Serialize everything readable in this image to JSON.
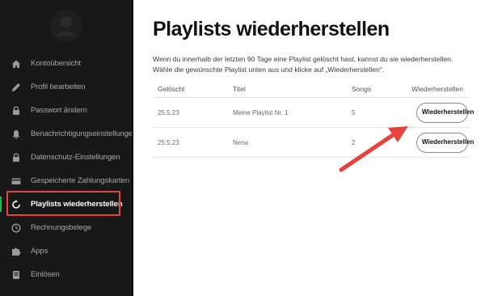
{
  "sidebar": {
    "items": [
      {
        "label": "Kontoübersicht",
        "icon": "home-icon",
        "active": false
      },
      {
        "label": "Profil bearbeiten",
        "icon": "pencil-icon",
        "active": false
      },
      {
        "label": "Passwort ändern",
        "icon": "lock-icon",
        "active": false
      },
      {
        "label": "Benachrichtigungseinstellungen",
        "icon": "bell-icon",
        "active": false
      },
      {
        "label": "Datenschutz-Einstellungen",
        "icon": "lock-icon",
        "active": false
      },
      {
        "label": "Gespeicherte Zahlungskarten",
        "icon": "credit-card-icon",
        "active": false
      },
      {
        "label": "Playlists wiederherstellen",
        "icon": "restore-icon",
        "active": true
      },
      {
        "label": "Rechnungsbelege",
        "icon": "clock-icon",
        "active": false
      },
      {
        "label": "Apps",
        "icon": "puzzle-icon",
        "active": false
      },
      {
        "label": "Einlösen",
        "icon": "redeem-icon",
        "active": false
      }
    ]
  },
  "main": {
    "title": "Playlists wiederherstellen",
    "description": "Wenn du innerhalb der letzten 90 Tage eine Playlist gelöscht hast, kannst du sie wiederherstellen. Wähle die gewünschte Playlist unten aus und klicke auf „Wiederherstellen\".",
    "table": {
      "headers": {
        "date": "Gelöscht",
        "title": "Titel",
        "songs": "Songs",
        "restore": "Wiederherstellen"
      },
      "rows": [
        {
          "date": "25.5.23",
          "title": "Meine Playlist Nr. 1",
          "songs": "5",
          "button": "Wiederherstellen"
        },
        {
          "date": "25.5.23",
          "title": "Nena",
          "songs": "2",
          "button": "Wiederherstellen"
        }
      ]
    }
  },
  "colors": {
    "sidebar_bg": "#181818",
    "accent_green": "#1db954",
    "annotation_red": "#e5433b"
  }
}
